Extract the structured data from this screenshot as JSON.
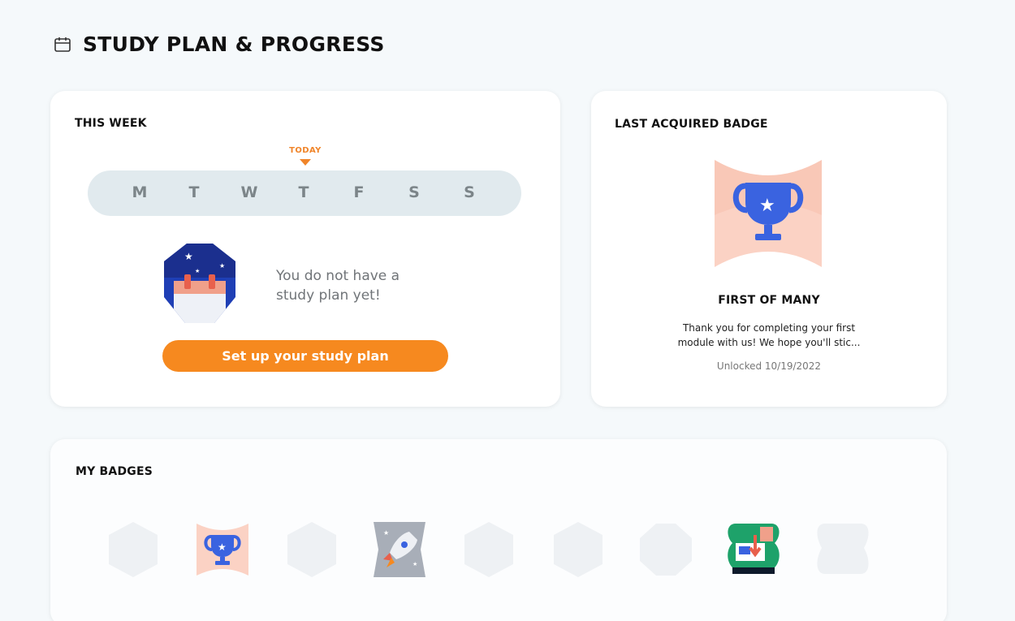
{
  "header": {
    "title": "STUDY PLAN & PROGRESS",
    "icon": "calendar-icon"
  },
  "this_week": {
    "title": "THIS WEEK",
    "today_label": "TODAY",
    "days": [
      "M",
      "T",
      "W",
      "T",
      "F",
      "S",
      "S"
    ],
    "today_index": 3,
    "empty_message": "You do not have a study plan yet!",
    "cta_label": "Set up your study plan"
  },
  "last_badge": {
    "title": "LAST ACQUIRED BADGE",
    "name": "FIRST OF MANY",
    "description": "Thank you for completing your first module with us! We hope you'll stic...",
    "unlocked": "Unlocked 10/19/2022",
    "icon": "trophy-icon"
  },
  "my_badges": {
    "title": "MY BADGES",
    "items": [
      {
        "icon": "locked-hexagon-icon",
        "unlocked": false
      },
      {
        "icon": "trophy-icon",
        "unlocked": true
      },
      {
        "icon": "locked-hexagon-icon",
        "unlocked": false
      },
      {
        "icon": "rocket-icon",
        "unlocked": true
      },
      {
        "icon": "locked-hexagon-icon",
        "unlocked": false
      },
      {
        "icon": "locked-hexagon-icon",
        "unlocked": false
      },
      {
        "icon": "locked-octagon-icon",
        "unlocked": false
      },
      {
        "icon": "download-laptop-icon",
        "unlocked": true
      },
      {
        "icon": "locked-blob-icon",
        "unlocked": false
      }
    ]
  },
  "colors": {
    "accent": "#f6891f",
    "badge_blue": "#3a63e0",
    "badge_peach": "#fbd2c4"
  }
}
